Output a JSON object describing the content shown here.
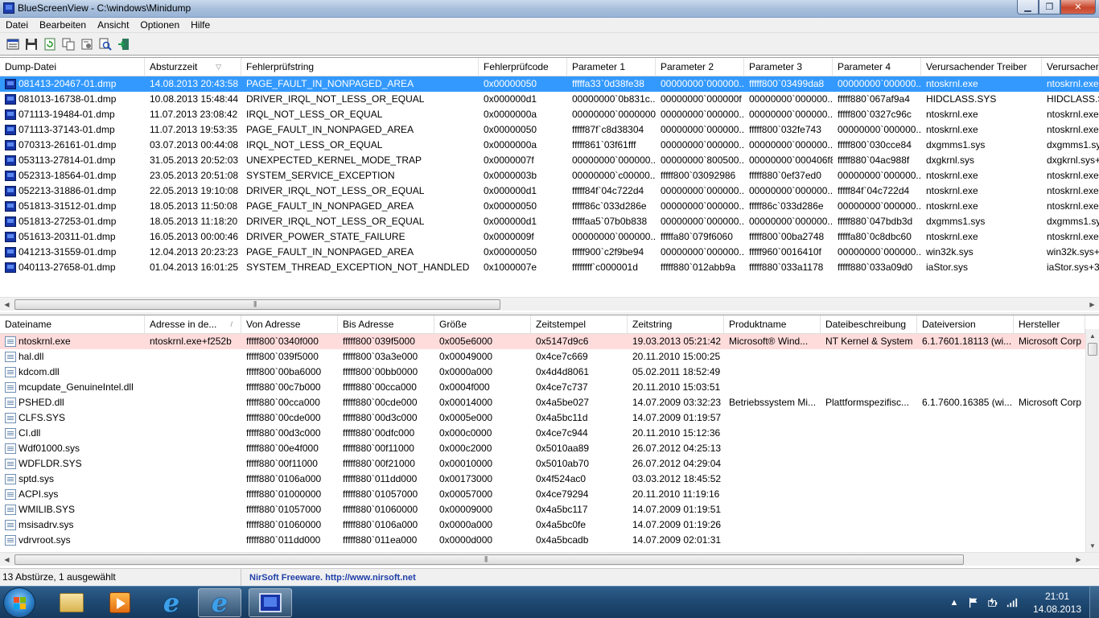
{
  "window": {
    "title": "BlueScreenView  -  C:\\windows\\Minidump",
    "minimize": "▁",
    "maximize": "❐",
    "close": "✕"
  },
  "menu": [
    "Datei",
    "Bearbeiten",
    "Ansicht",
    "Optionen",
    "Hilfe"
  ],
  "toolbar": {
    "icons": [
      "properties-icon",
      "save-icon",
      "refresh-icon",
      "copy-icon",
      "options-icon",
      "find-icon",
      "exit-icon"
    ]
  },
  "dumps": {
    "columns": [
      "Dump-Datei",
      "Absturzzeit",
      "Fehlerprüfstring",
      "Fehlerprüfcode",
      "Parameter 1",
      "Parameter 2",
      "Parameter 3",
      "Parameter 4",
      "Verursachender Treiber",
      "Verursacher"
    ],
    "sort_indicator": "▽",
    "rows": [
      [
        "081413-20467-01.dmp",
        "14.08.2013 20:43:58",
        "PAGE_FAULT_IN_NONPAGED_AREA",
        "0x00000050",
        "fffffa33`0d38fe38",
        "00000000`000000...",
        "fffff800`03499da8",
        "00000000`000000...",
        "ntoskrnl.exe",
        "ntoskrnl.exe"
      ],
      [
        "081013-16738-01.dmp",
        "10.08.2013 15:48:44",
        "DRIVER_IRQL_NOT_LESS_OR_EQUAL",
        "0x000000d1",
        "00000000`0b831c...",
        "00000000`000000f",
        "00000000`000000...",
        "fffff880`067af9a4",
        "HIDCLASS.SYS",
        "HIDCLASS.S"
      ],
      [
        "071113-19484-01.dmp",
        "11.07.2013 23:08:42",
        "IRQL_NOT_LESS_OR_EQUAL",
        "0x0000000a",
        "00000000`0000000f",
        "00000000`000000...",
        "00000000`000000...",
        "fffff800`0327c96c",
        "ntoskrnl.exe",
        "ntoskrnl.exe"
      ],
      [
        "071113-37143-01.dmp",
        "11.07.2013 19:53:35",
        "PAGE_FAULT_IN_NONPAGED_AREA",
        "0x00000050",
        "fffff87f`c8d38304",
        "00000000`000000...",
        "fffff800`032fe743",
        "00000000`000000...",
        "ntoskrnl.exe",
        "ntoskrnl.exe"
      ],
      [
        "070313-26161-01.dmp",
        "03.07.2013 00:44:08",
        "IRQL_NOT_LESS_OR_EQUAL",
        "0x0000000a",
        "fffff861`03f61fff",
        "00000000`000000...",
        "00000000`000000...",
        "fffff800`030cce84",
        "dxgmms1.sys",
        "dxgmms1.sy"
      ],
      [
        "053113-27814-01.dmp",
        "31.05.2013 20:52:03",
        "UNEXPECTED_KERNEL_MODE_TRAP",
        "0x0000007f",
        "00000000`000000...",
        "00000000`800500...",
        "00000000`000406f8",
        "fffff880`04ac988f",
        "dxgkrnl.sys",
        "dxgkrnl.sys+"
      ],
      [
        "052313-18564-01.dmp",
        "23.05.2013 20:51:08",
        "SYSTEM_SERVICE_EXCEPTION",
        "0x0000003b",
        "00000000`c00000...",
        "fffff800`03092986",
        "fffff880`0ef37ed0",
        "00000000`000000...",
        "ntoskrnl.exe",
        "ntoskrnl.exe"
      ],
      [
        "052213-31886-01.dmp",
        "22.05.2013 19:10:08",
        "DRIVER_IRQL_NOT_LESS_OR_EQUAL",
        "0x000000d1",
        "fffff84f`04c722d4",
        "00000000`000000...",
        "00000000`000000...",
        "fffff84f`04c722d4",
        "ntoskrnl.exe",
        "ntoskrnl.exe"
      ],
      [
        "051813-31512-01.dmp",
        "18.05.2013 11:50:08",
        "PAGE_FAULT_IN_NONPAGED_AREA",
        "0x00000050",
        "fffff86c`033d286e",
        "00000000`000000...",
        "fffff86c`033d286e",
        "00000000`000000...",
        "ntoskrnl.exe",
        "ntoskrnl.exe"
      ],
      [
        "051813-27253-01.dmp",
        "18.05.2013 11:18:20",
        "DRIVER_IRQL_NOT_LESS_OR_EQUAL",
        "0x000000d1",
        "fffffaa5`07b0b838",
        "00000000`000000...",
        "00000000`000000...",
        "fffff880`047bdb3d",
        "dxgmms1.sys",
        "dxgmms1.sy"
      ],
      [
        "051613-20311-01.dmp",
        "16.05.2013 00:00:46",
        "DRIVER_POWER_STATE_FAILURE",
        "0x0000009f",
        "00000000`000000...",
        "fffffa80`079f6060",
        "fffff800`00ba2748",
        "fffffa80`0c8dbc60",
        "ntoskrnl.exe",
        "ntoskrnl.exe"
      ],
      [
        "041213-31559-01.dmp",
        "12.04.2013 20:23:23",
        "PAGE_FAULT_IN_NONPAGED_AREA",
        "0x00000050",
        "fffff900`c2f9be94",
        "00000000`000000...",
        "fffff960`0016410f",
        "00000000`000000...",
        "win32k.sys",
        "win32k.sys+"
      ],
      [
        "040113-27658-01.dmp",
        "01.04.2013 16:01:25",
        "SYSTEM_THREAD_EXCEPTION_NOT_HANDLED",
        "0x1000007e",
        "ffffffff`c000001d",
        "fffff880`012abb9a",
        "fffff880`033a1178",
        "fffff880`033a09d0",
        "iaStor.sys",
        "iaStor.sys+3"
      ]
    ]
  },
  "drivers": {
    "columns": [
      "Dateiname",
      "Adresse in de...",
      "Von Adresse",
      "Bis Adresse",
      "Größe",
      "Zeitstempel",
      "Zeitstring",
      "Produktname",
      "Dateibeschreibung",
      "Dateiversion",
      "Hersteller"
    ],
    "sort_indicator": "/",
    "rows": [
      [
        "ntoskrnl.exe",
        "ntoskrnl.exe+f252b",
        "fffff800`0340f000",
        "fffff800`039f5000",
        "0x005e6000",
        "0x5147d9c6",
        "19.03.2013 05:21:42",
        "Microsoft® Wind...",
        "NT Kernel & System",
        "6.1.7601.18113 (wi...",
        "Microsoft Corp"
      ],
      [
        "hal.dll",
        "",
        "fffff800`039f5000",
        "fffff800`03a3e000",
        "0x00049000",
        "0x4ce7c669",
        "20.11.2010 15:00:25",
        "",
        "",
        "",
        ""
      ],
      [
        "kdcom.dll",
        "",
        "fffff800`00ba6000",
        "fffff800`00bb0000",
        "0x0000a000",
        "0x4d4d8061",
        "05.02.2011 18:52:49",
        "",
        "",
        "",
        ""
      ],
      [
        "mcupdate_GenuineIntel.dll",
        "",
        "fffff880`00c7b000",
        "fffff880`00cca000",
        "0x0004f000",
        "0x4ce7c737",
        "20.11.2010 15:03:51",
        "",
        "",
        "",
        ""
      ],
      [
        "PSHED.dll",
        "",
        "fffff880`00cca000",
        "fffff880`00cde000",
        "0x00014000",
        "0x4a5be027",
        "14.07.2009 03:32:23",
        "Betriebssystem Mi...",
        "Plattformspezifisc...",
        "6.1.7600.16385 (wi...",
        "Microsoft Corp"
      ],
      [
        "CLFS.SYS",
        "",
        "fffff880`00cde000",
        "fffff880`00d3c000",
        "0x0005e000",
        "0x4a5bc11d",
        "14.07.2009 01:19:57",
        "",
        "",
        "",
        ""
      ],
      [
        "CI.dll",
        "",
        "fffff880`00d3c000",
        "fffff880`00dfc000",
        "0x000c0000",
        "0x4ce7c944",
        "20.11.2010 15:12:36",
        "",
        "",
        "",
        ""
      ],
      [
        "Wdf01000.sys",
        "",
        "fffff880`00e4f000",
        "fffff880`00f11000",
        "0x000c2000",
        "0x5010aa89",
        "26.07.2012 04:25:13",
        "",
        "",
        "",
        ""
      ],
      [
        "WDFLDR.SYS",
        "",
        "fffff880`00f11000",
        "fffff880`00f21000",
        "0x00010000",
        "0x5010ab70",
        "26.07.2012 04:29:04",
        "",
        "",
        "",
        ""
      ],
      [
        "sptd.sys",
        "",
        "fffff880`0106a000",
        "fffff880`011dd000",
        "0x00173000",
        "0x4f524ac0",
        "03.03.2012 18:45:52",
        "",
        "",
        "",
        ""
      ],
      [
        "ACPI.sys",
        "",
        "fffff880`01000000",
        "fffff880`01057000",
        "0x00057000",
        "0x4ce79294",
        "20.11.2010 11:19:16",
        "",
        "",
        "",
        ""
      ],
      [
        "WMILIB.SYS",
        "",
        "fffff880`01057000",
        "fffff880`01060000",
        "0x00009000",
        "0x4a5bc117",
        "14.07.2009 01:19:51",
        "",
        "",
        "",
        ""
      ],
      [
        "msisadrv.sys",
        "",
        "fffff880`01060000",
        "fffff880`0106a000",
        "0x0000a000",
        "0x4a5bc0fe",
        "14.07.2009 01:19:26",
        "",
        "",
        "",
        ""
      ],
      [
        "vdrvroot.sys",
        "",
        "fffff880`011dd000",
        "fffff880`011ea000",
        "0x0000d000",
        "0x4a5bcadb",
        "14.07.2009 02:01:31",
        "",
        "",
        "",
        ""
      ]
    ]
  },
  "status": {
    "count": "13 Abstürze, 1 ausgewählt",
    "link": "NirSoft Freeware.  http://www.nirsoft.net"
  },
  "scroll": {
    "left": "◀",
    "right": "▶",
    "up": "▲",
    "down": "▼",
    "grip": "|||"
  },
  "taskbar": {
    "tray_arrow": "▲",
    "clock_time": "21:01",
    "clock_date": "14.08.2013"
  },
  "colors": {
    "selection": "#3399ff",
    "highlight_row": "#ffdcdc",
    "link": "#1f3fa8"
  }
}
